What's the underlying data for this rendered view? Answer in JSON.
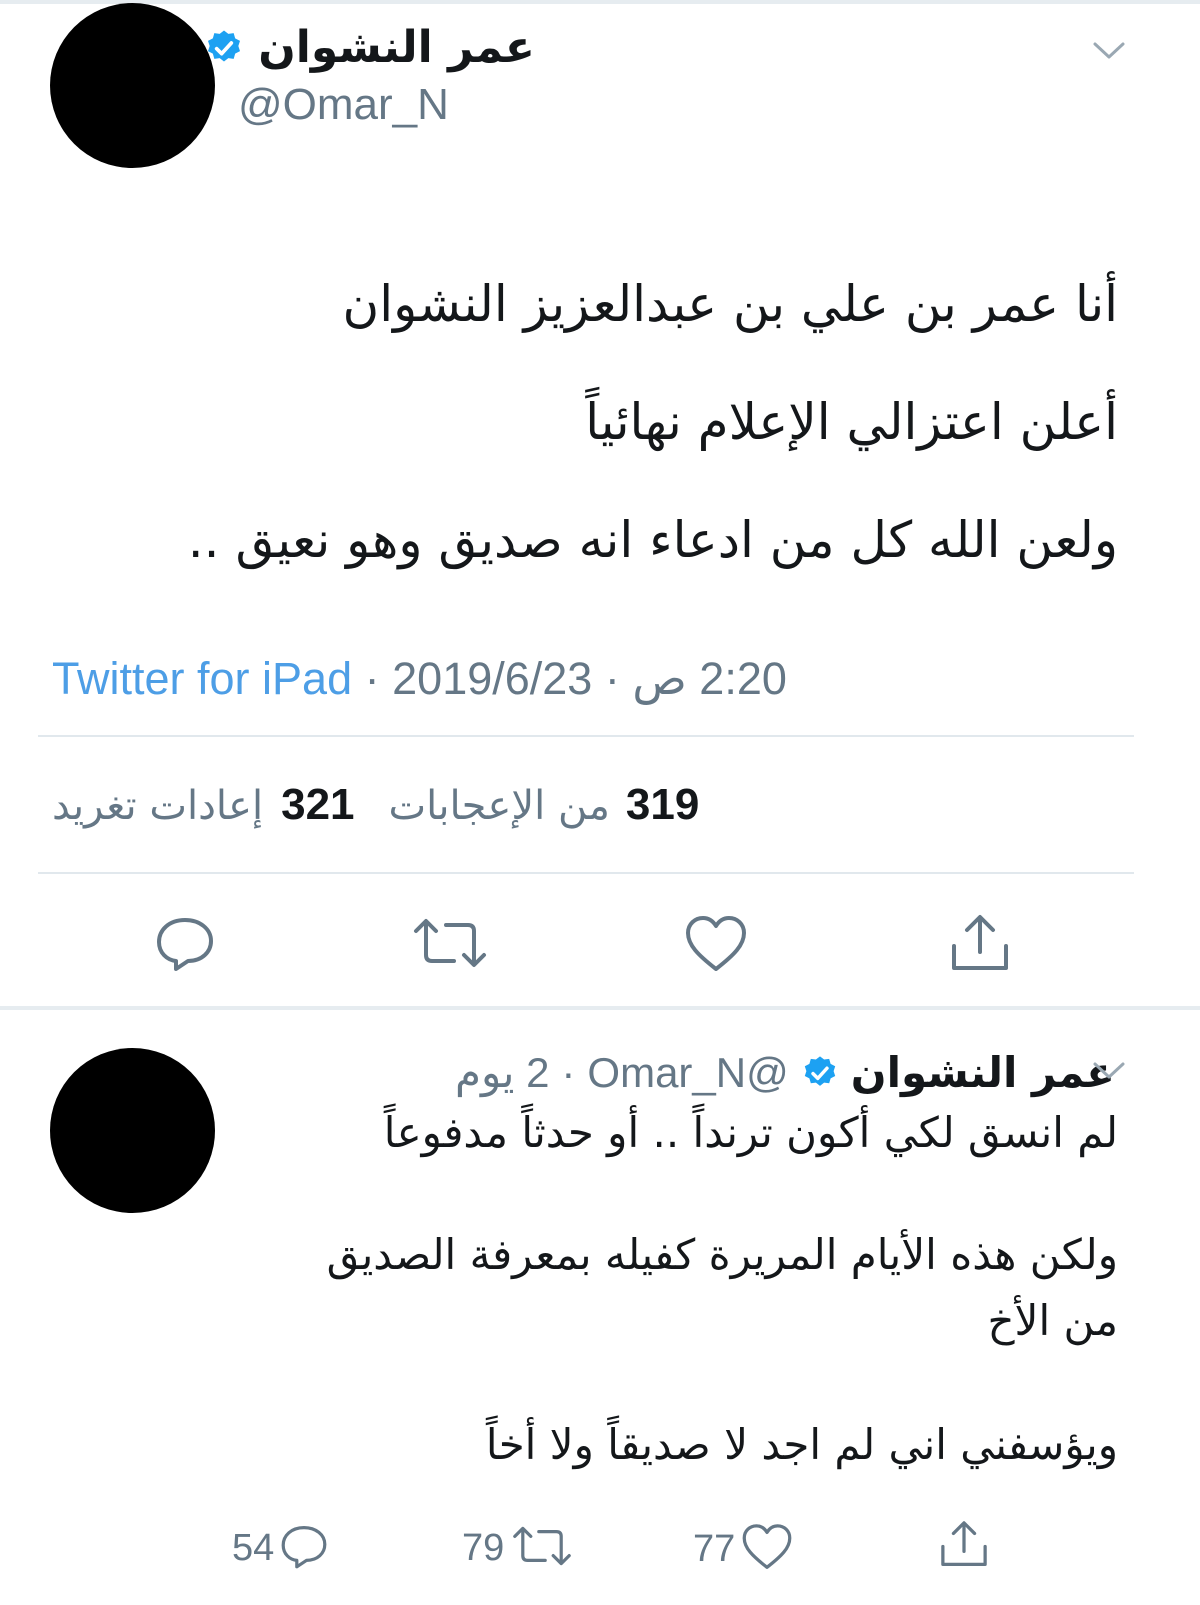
{
  "main_tweet": {
    "display_name": "عمر النشوان",
    "handle": "@Omar_N",
    "text_lines": [
      "أنا عمر بن علي بن عبدالعزيز النشوان",
      "أعلن اعتزالي الإعلام نهائياً",
      "ولعن الله كل من ادعاء انه صديق وهو نعيق .."
    ],
    "source": "Twitter for iPad",
    "date": "2019/6/23",
    "time": "2:20 ص",
    "separator": "·",
    "retweets_count": "321",
    "retweets_label": "إعادات تغريد",
    "likes_count": "319",
    "likes_label": "من الإعجابات",
    "icons": [
      "reply-icon",
      "retweet-icon",
      "like-icon",
      "share-icon",
      "verified-badge-icon",
      "chevron-down-icon"
    ]
  },
  "reply_tweet": {
    "display_name": "عمر النشوان",
    "handle": "@Omar_N",
    "time_ago": "2 يوم",
    "separator": "·",
    "text_lines": [
      "لم انسق لكي أكون ترنداً .. أو حدثاً مدفوعاً",
      "ولكن هذه الأيام المريرة كفيله بمعرفة الصديق",
      "من الأخ",
      "ويؤسفني اني لم اجد لا صديقاً ولا أخاً"
    ],
    "reply_count": "54",
    "retweet_count": "79",
    "like_count": "77"
  },
  "colors": {
    "text": "#14171a",
    "secondary": "#657786",
    "link": "#4d9ee6",
    "verified": "#1da1f2",
    "divider": "#e1e8ed"
  }
}
